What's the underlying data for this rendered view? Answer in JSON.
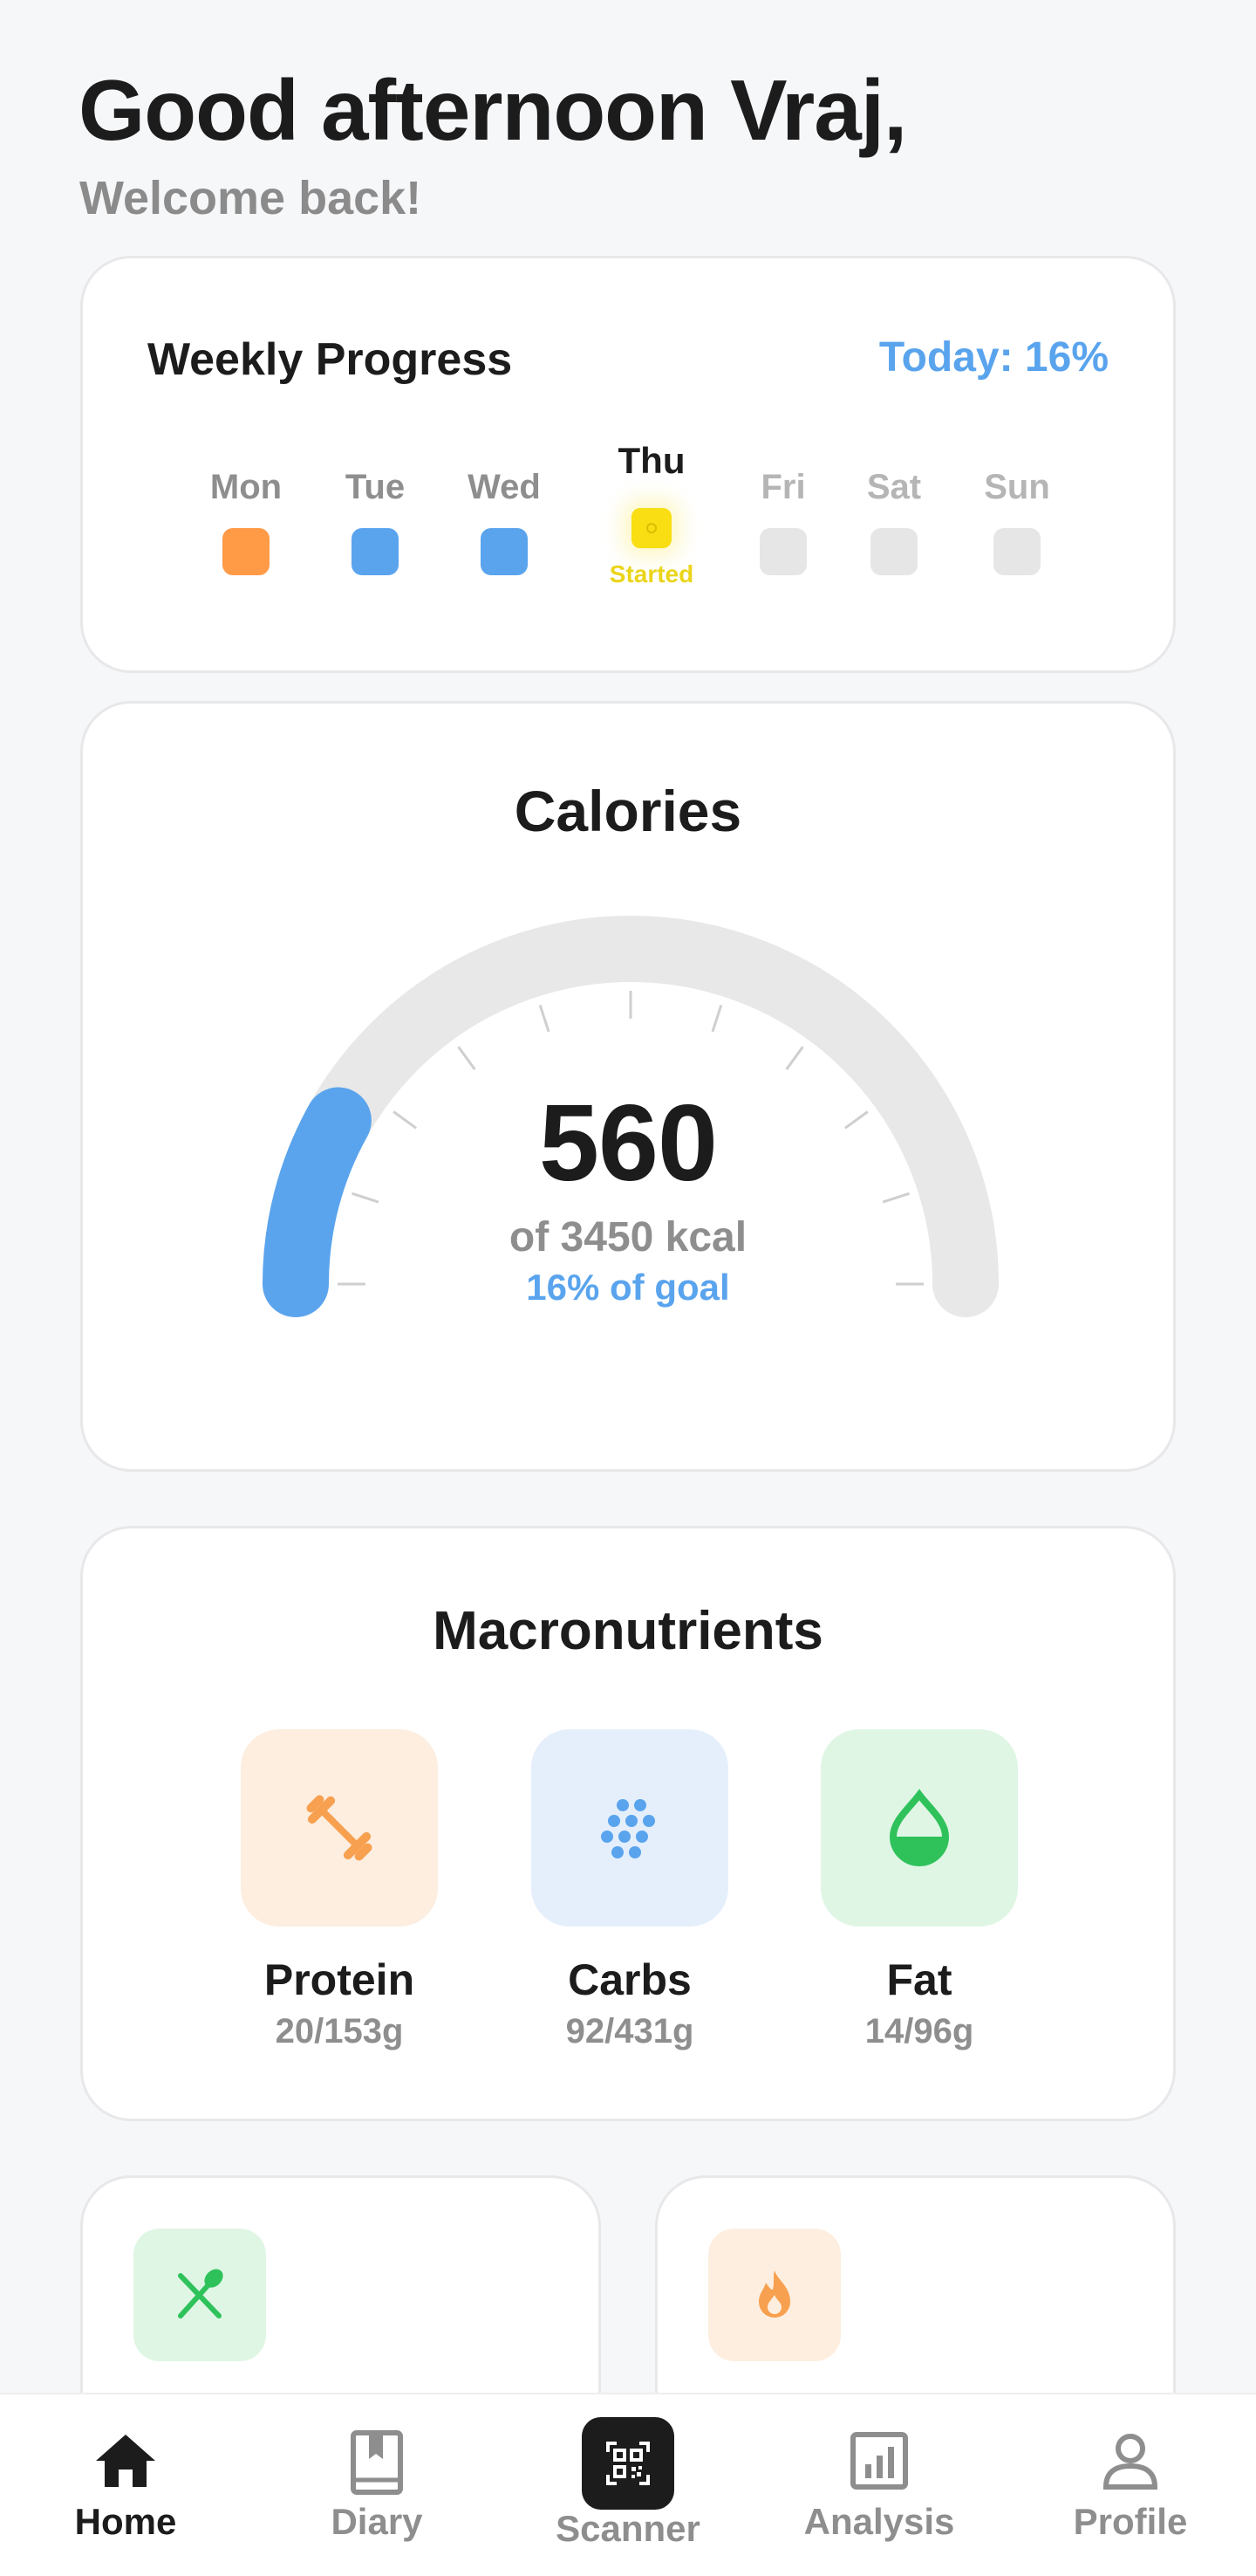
{
  "greeting": {
    "title": "Good afternoon Vraj,",
    "subtitle": "Welcome back!"
  },
  "weekly": {
    "title": "Weekly Progress",
    "today_label": "Today: 16%",
    "days": [
      {
        "label": "Mon",
        "state": "done",
        "color": "#ff9a47"
      },
      {
        "label": "Tue",
        "state": "done",
        "color": "#5aa4ee"
      },
      {
        "label": "Wed",
        "state": "done",
        "color": "#5aa4ee"
      },
      {
        "label": "Thu",
        "state": "today",
        "color": "#f8de12",
        "status": "Started"
      },
      {
        "label": "Fri",
        "state": "future",
        "color": "#e6e6e6"
      },
      {
        "label": "Sat",
        "state": "future",
        "color": "#e6e6e6"
      },
      {
        "label": "Sun",
        "state": "future",
        "color": "#e6e6e6"
      }
    ]
  },
  "calories": {
    "title": "Calories",
    "value": "560",
    "of_text": "of 3450 kcal",
    "goal_text": "16% of goal",
    "consumed": 560,
    "goal": 3450,
    "progress_fraction": 0.16,
    "accent_color": "#5aa4ee",
    "track_color": "#e8e8e8"
  },
  "macros": {
    "title": "Macronutrients",
    "items": [
      {
        "name": "Protein",
        "amount": "20/153g",
        "icon": "dumbbell-icon",
        "color": "#f7a04f",
        "bg": "#fdeee0"
      },
      {
        "name": "Carbs",
        "amount": "92/431g",
        "icon": "grains-icon",
        "color": "#5aa4ee",
        "bg": "#e5effc"
      },
      {
        "name": "Fat",
        "amount": "14/96g",
        "icon": "droplet-icon",
        "color": "#2fc25b",
        "bg": "#dff6e5"
      }
    ]
  },
  "small_cards": [
    {
      "icon": "utensils-icon",
      "color": "#2fc25b",
      "bg": "#dff6e5"
    },
    {
      "icon": "flame-icon",
      "color": "#f7a04f",
      "bg": "#fdeee0"
    }
  ],
  "tabs": [
    {
      "label": "Home",
      "icon": "home-icon",
      "active": true
    },
    {
      "label": "Diary",
      "icon": "book-icon",
      "active": false
    },
    {
      "label": "Scanner",
      "icon": "qr-scanner-icon",
      "active": false
    },
    {
      "label": "Analysis",
      "icon": "bar-chart-icon",
      "active": false
    },
    {
      "label": "Profile",
      "icon": "user-icon",
      "active": false
    }
  ]
}
